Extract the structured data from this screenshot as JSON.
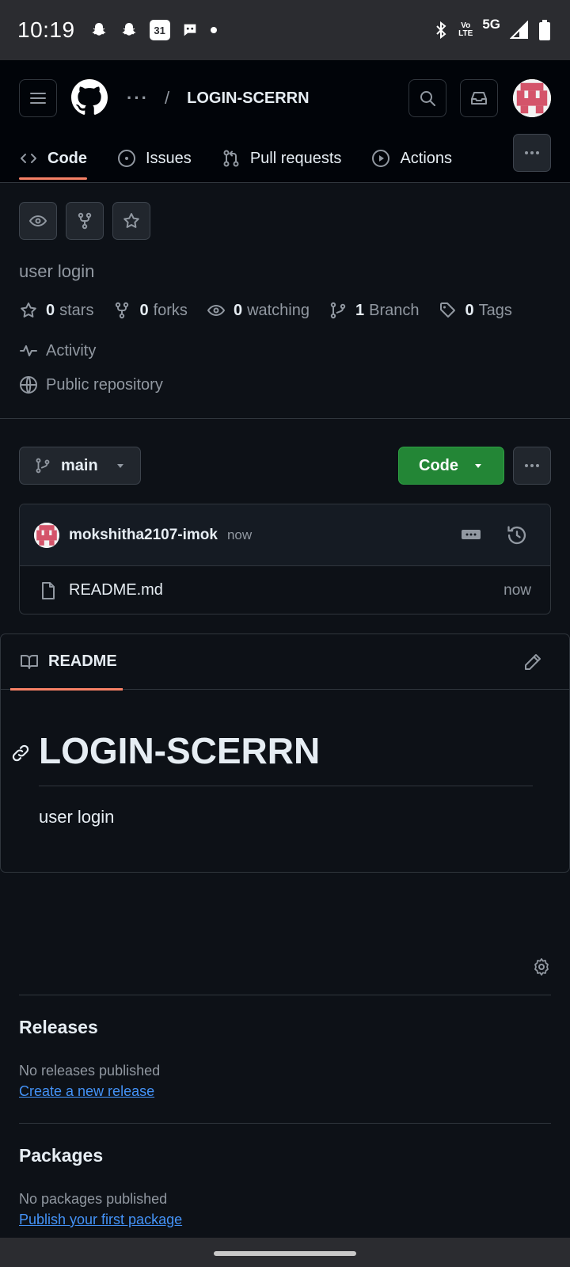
{
  "status_bar": {
    "time": "10:19",
    "network": "5G",
    "volte": "Vo\nLTE",
    "notification_icons": [
      "snapchat-icon",
      "snapchat-icon",
      "calendar-icon",
      "messaging-icon",
      "dot-icon"
    ],
    "calendar_day": "31"
  },
  "header": {
    "breadcrumb_more": "···",
    "separator": "/",
    "repo_name": "LOGIN-SCERRN",
    "tabs": [
      {
        "label": "Code",
        "icon": "code-icon",
        "active": true
      },
      {
        "label": "Issues",
        "icon": "issue-icon",
        "active": false
      },
      {
        "label": "Pull requests",
        "icon": "pull-request-icon",
        "active": false
      },
      {
        "label": "Actions",
        "icon": "play-icon",
        "active": false
      }
    ]
  },
  "repo": {
    "description": "user login",
    "stats": {
      "stars_count": "0",
      "stars_label": "stars",
      "forks_count": "0",
      "forks_label": "forks",
      "watching_count": "0",
      "watching_label": "watching",
      "branch_count": "1",
      "branch_label": "Branch",
      "tags_count": "0",
      "tags_label": "Tags"
    },
    "activity_label": "Activity",
    "visibility": "Public repository"
  },
  "branch": {
    "name": "main"
  },
  "code_button": {
    "label": "Code"
  },
  "latest_commit": {
    "author": "mokshitha2107-imok",
    "time": "now"
  },
  "files": [
    {
      "name": "README.md",
      "time": "now"
    }
  ],
  "readme": {
    "tab_label": "README",
    "heading": "LOGIN-SCERRN",
    "body": "user login"
  },
  "releases": {
    "title": "Releases",
    "note": "No releases published",
    "link": "Create a new release"
  },
  "packages": {
    "title": "Packages",
    "note": "No packages published",
    "link": "Publish your first package"
  },
  "colors": {
    "background": "#0d1117",
    "header": "#010409",
    "accent_underline": "#f78166",
    "code_button": "#238636",
    "link": "#4493f8",
    "muted_text": "#9198a1"
  }
}
